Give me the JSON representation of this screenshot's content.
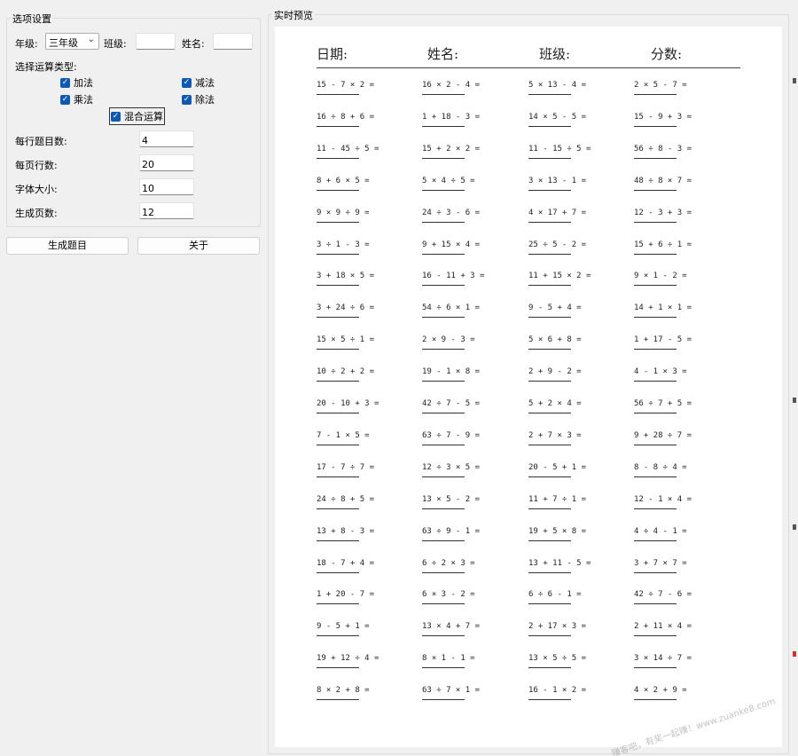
{
  "options_group": {
    "title": "选项设置",
    "grade_label": "年级:",
    "grade_value": "三年级",
    "class_label": "班级:",
    "class_value": "",
    "name_label": "姓名:",
    "name_value": "",
    "op_types_label": "选择运算类型:",
    "ops": {
      "add": {
        "label": "加法",
        "checked": true
      },
      "sub": {
        "label": "减法",
        "checked": true
      },
      "mul": {
        "label": "乘法",
        "checked": true
      },
      "div": {
        "label": "除法",
        "checked": true
      },
      "mixed": {
        "label": "混合运算",
        "checked": true
      }
    },
    "per_row_label": "每行题目数:",
    "per_row_value": "4",
    "rows_per_page_label": "每页行数:",
    "rows_per_page_value": "20",
    "font_size_label": "字体大小:",
    "font_size_value": "10",
    "pages_label": "生成页数:",
    "pages_value": "12"
  },
  "buttons": {
    "generate": "生成题目",
    "about": "关于"
  },
  "preview": {
    "title": "实时预览",
    "header": {
      "date": "日期:",
      "name": "姓名:",
      "class": "班级:",
      "score": "分数:"
    },
    "problems": [
      [
        "15 - 7 × 2 =",
        "16 × 2 - 4 =",
        "5 × 13 - 4 =",
        "2 × 5 - 7 ="
      ],
      [
        "16 ÷ 8 + 6 =",
        "1 + 18 - 3 =",
        "14 × 5 - 5 =",
        "15 - 9 + 3 ="
      ],
      [
        "11 - 45 ÷ 5 =",
        "15 + 2 × 2 =",
        "11 - 15 ÷ 5 =",
        "56 ÷ 8 - 3 ="
      ],
      [
        "8 + 6 × 5 =",
        "5 × 4 ÷ 5 =",
        "3 × 13 - 1 =",
        "48 ÷ 8 × 7 ="
      ],
      [
        "9 × 9 ÷ 9 =",
        "24 ÷ 3 - 6 =",
        "4 × 17 + 7 =",
        "12 - 3 + 3 ="
      ],
      [
        "3 ÷ 1 - 3 =",
        "9 + 15 × 4 =",
        "25 ÷ 5 - 2 =",
        "15 + 6 ÷ 1 ="
      ],
      [
        "3 + 18 × 5 =",
        "16 - 11 + 3 =",
        "11 + 15 × 2 =",
        "9 × 1 - 2 ="
      ],
      [
        "3 + 24 ÷ 6 =",
        "54 ÷ 6 × 1 =",
        "9 - 5 + 4 =",
        "14 + 1 × 1 ="
      ],
      [
        "15 × 5 ÷ 1 =",
        "2 × 9 - 3 =",
        "5 × 6 + 8 =",
        "1 + 17 - 5 ="
      ],
      [
        "10 ÷ 2 + 2 =",
        "19 - 1 × 8 =",
        "2 + 9 - 2 =",
        "4 - 1 × 3 ="
      ],
      [
        "20 - 10 + 3 =",
        "42 ÷ 7 - 5 =",
        "5 + 2 × 4 =",
        "56 ÷ 7 + 5 ="
      ],
      [
        "7 - 1 × 5 =",
        "63 ÷ 7 - 9 =",
        "2 + 7 × 3 =",
        "9 + 28 ÷ 7 ="
      ],
      [
        "17 - 7 ÷ 7 =",
        "12 ÷ 3 × 5 =",
        "20 - 5 + 1 =",
        "8 - 8 ÷ 4 ="
      ],
      [
        "24 ÷ 8 + 5 =",
        "13 × 5 - 2 =",
        "11 + 7 ÷ 1 =",
        "12 - 1 × 4 ="
      ],
      [
        "13 + 8 - 3 =",
        "63 ÷ 9 - 1 =",
        "19 + 5 × 8 =",
        "4 ÷ 4 - 1 ="
      ],
      [
        "18 - 7 + 4 =",
        "6 ÷ 2 × 3 =",
        "13 + 11 - 5 =",
        "3 + 7 × 7 ="
      ],
      [
        "1 + 20 - 7 =",
        "6 × 3 - 2 =",
        "6 ÷ 6 - 1 =",
        "42 ÷ 7 - 6 ="
      ],
      [
        "9 - 5 + 1 =",
        "13 × 4 + 7 =",
        "2 + 17 × 3 =",
        "2 + 11 × 4 ="
      ],
      [
        "19 + 12 ÷ 4 =",
        "8 × 1 - 1 =",
        "13 × 5 ÷ 5 =",
        "3 × 14 ÷ 7 ="
      ],
      [
        "8 × 2 + 8 =",
        "63 ÷ 7 × 1 =",
        "16 - 1 × 2 =",
        "4 × 2 + 9 ="
      ]
    ]
  },
  "watermark": "赚客吧，有奖一起赚！www.zuanke8.com"
}
